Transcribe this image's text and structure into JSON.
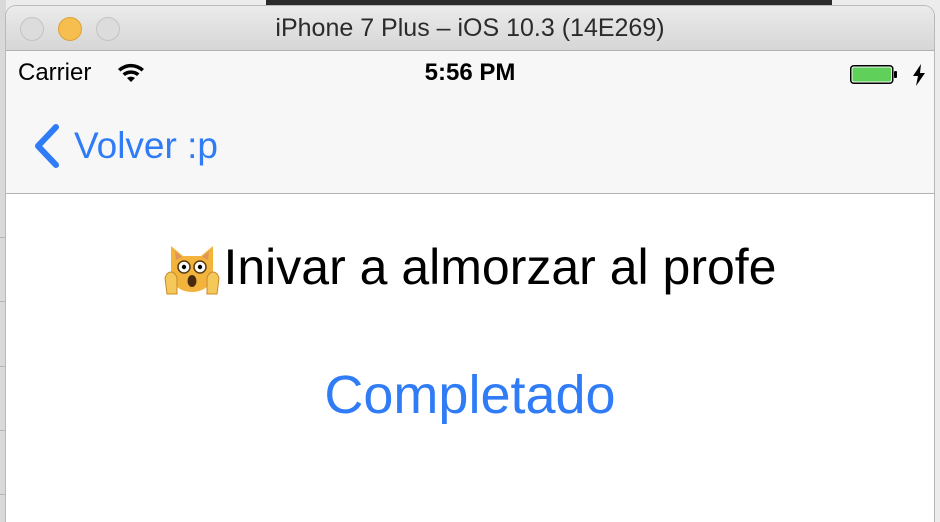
{
  "window": {
    "title": "iPhone 7 Plus – iOS 10.3 (14E269)"
  },
  "status_bar": {
    "carrier": "Carrier",
    "time": "5:56 PM",
    "wifi_icon": "wifi-icon",
    "battery_icon": "battery-icon",
    "charging_icon": "bolt-icon"
  },
  "nav": {
    "back_label": "Volver :p",
    "back_icon": "chevron-left-icon"
  },
  "task": {
    "emoji_icon": "weary-cat-icon",
    "title": "Inivar a almorzar al profe"
  },
  "actions": {
    "completed_label": "Completado"
  },
  "colors": {
    "accent": "#2f7cf6",
    "battery": "#5fd15b",
    "min_button": "#f5be4f"
  }
}
